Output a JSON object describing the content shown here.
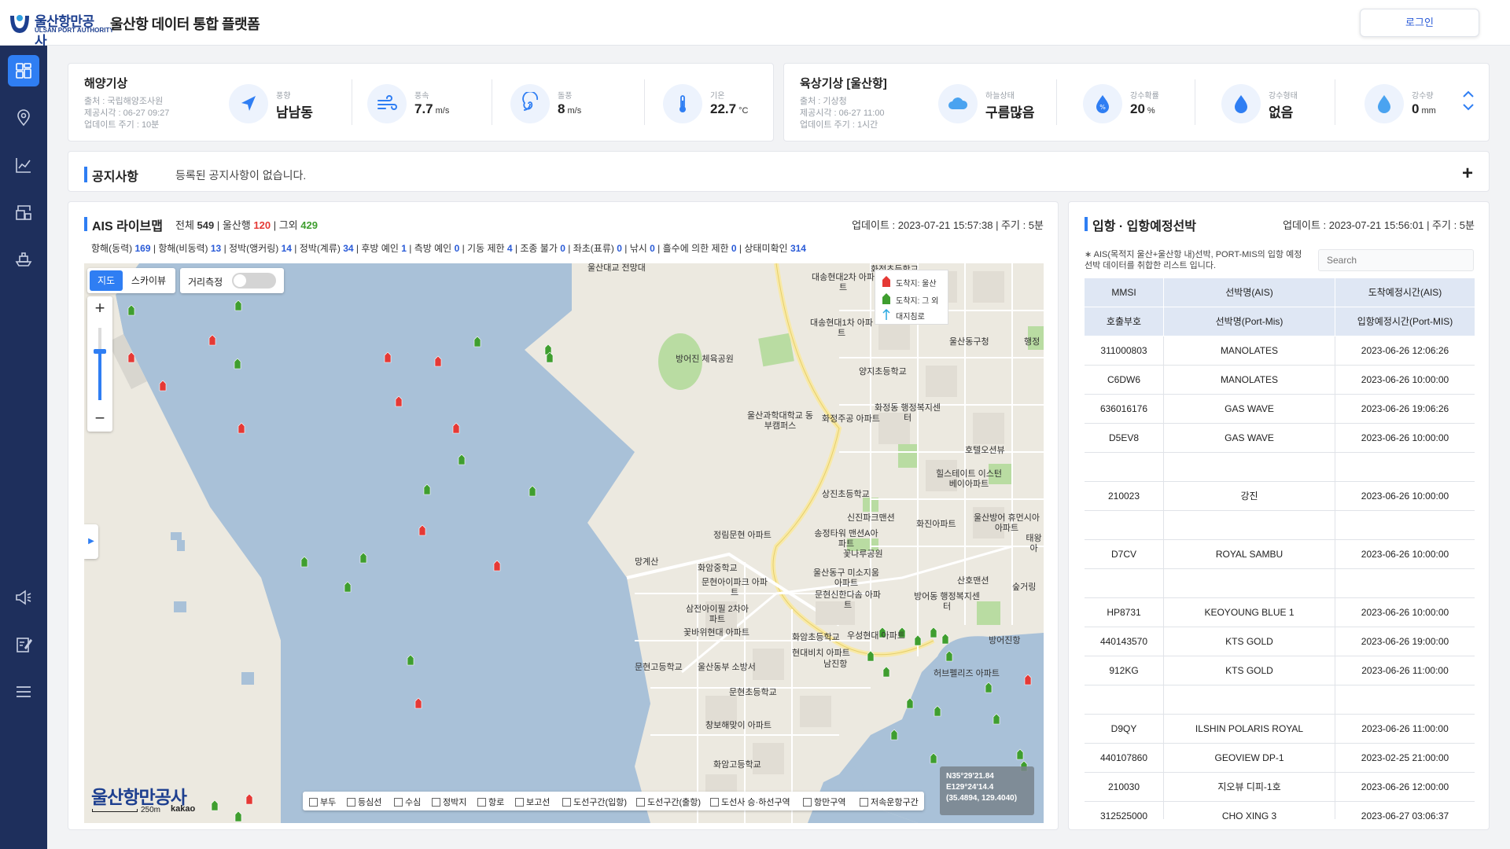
{
  "header": {
    "logo_ko": "울산항만공사",
    "logo_en": "ULSAN PORT AUTHORITY",
    "title": "울산항 데이터 통합 플랫폼",
    "login": "로그인"
  },
  "sidebar": {
    "items": [
      {
        "icon": "dashboard-icon",
        "active": true
      },
      {
        "icon": "location-pin-icon"
      },
      {
        "icon": "line-chart-icon"
      },
      {
        "icon": "port-crane-icon"
      },
      {
        "icon": "ship-icon"
      },
      {
        "icon": "megaphone-icon"
      },
      {
        "icon": "edit-note-icon"
      },
      {
        "icon": "menu-icon"
      }
    ]
  },
  "marine_weather": {
    "title": "해양기상",
    "source": "출처 : 국립해양조사원",
    "time": "제공시각 : 06-27 09:27",
    "cycle": "업데이트 주기 : 10분",
    "items": [
      {
        "icon": "wind-direction-icon",
        "label": "풍향",
        "value": "남남동",
        "unit": ""
      },
      {
        "icon": "wind-icon",
        "label": "풍속",
        "value": "7.7",
        "unit": "m/s"
      },
      {
        "icon": "gust-icon",
        "label": "돌풍",
        "value": "8",
        "unit": "m/s"
      },
      {
        "icon": "thermometer-icon",
        "label": "기온",
        "value": "22.7",
        "unit": "°C"
      }
    ]
  },
  "land_weather": {
    "title": "육상기상 [울산항]",
    "source": "출처 : 기상청",
    "time": "제공시각 : 06-27 11:00",
    "cycle": "업데이트 주기 : 1시간",
    "items": [
      {
        "icon": "cloud-icon",
        "label": "하늘상태",
        "value": "구름많음",
        "unit": ""
      },
      {
        "icon": "rain-probability-icon",
        "label": "강수확률",
        "value": "20",
        "unit": "%"
      },
      {
        "icon": "rain-type-icon",
        "label": "강수형태",
        "value": "없음",
        "unit": ""
      },
      {
        "icon": "raindrop-icon",
        "label": "강수량",
        "value": "0",
        "unit": "mm"
      }
    ]
  },
  "notice": {
    "title": "공지사항",
    "text": "등록된 공지사항이 없습니다.",
    "add": "+"
  },
  "ais": {
    "title": "AIS 라이브맵",
    "total_label": "전체",
    "total": "549",
    "ulsan_label": "울산행",
    "ulsan": "120",
    "other_label": "그외",
    "other": "429",
    "update": "업데이트 : 2023-07-21 15:57:38 | 주기 : 5분",
    "status": [
      {
        "label": "항해(동력)",
        "value": "169"
      },
      {
        "label": "항해(비동력)",
        "value": "13"
      },
      {
        "label": "정박(앵커링)",
        "value": "14"
      },
      {
        "label": "정박(계류)",
        "value": "34"
      },
      {
        "label": "후방 예인",
        "value": "1"
      },
      {
        "label": "측방 예인",
        "value": "0"
      },
      {
        "label": "기동 제한",
        "value": "4"
      },
      {
        "label": "조종 불가",
        "value": "0"
      },
      {
        "label": "좌초(표류)",
        "value": "0"
      },
      {
        "label": "낚시",
        "value": "0"
      },
      {
        "label": "흘수에 의한 제한",
        "value": "0"
      },
      {
        "label": "상태미확인",
        "value": "314"
      }
    ],
    "map": {
      "tab_map": "지도",
      "tab_sky": "스카이뷰",
      "distance": "거리측정",
      "distance_on": false,
      "zoom_level": 0.67,
      "zoom_in": "+",
      "zoom_out": "−",
      "legend": [
        "도착지: 울산",
        "도착지: 그 외",
        "대지침로"
      ],
      "legend_colors": [
        "#e53935",
        "#3f9e2f",
        "#29a8e0"
      ],
      "coord": [
        "N35°29'21.84",
        "E129°24'14.4",
        "(35.4894, 129.4040)"
      ],
      "brand": "울산항만공사",
      "scale": "250m",
      "kakao": "kakao",
      "layers": [
        "부두",
        "등심선",
        "수심",
        "정박지",
        "항로",
        "보고선",
        "도선구간(입항)",
        "도선구간(출항)",
        "도선사 승·하선구역",
        "항만구역",
        "저속운항구간"
      ],
      "places": [
        "울산대교 전망대",
        "화정초등학교",
        "대송현대2차 아파트",
        "대송현대1차 아파트",
        "방어진 체육공원",
        "양지초등학교",
        "화정동 행정복지센터",
        "울산과학대학교 동부캠퍼스",
        "화정주공 아파트",
        "울산동구청",
        "행정",
        "호텔오션뷰",
        "힐스테이트 이스턴베이아파트",
        "상진초등학교",
        "신진파크맨션",
        "화진아파트",
        "울산방어 휴먼시아아파트",
        "태왕 아",
        "정림문현 아파트",
        "망계산",
        "송정타워 맨션A아파트",
        "꽃나루공원",
        "화암중학교",
        "울산동구 미소지움아파트",
        "산호맨션",
        "숲거링",
        "문현아이파크 아파트",
        "문현신한다솜 아파트",
        "방어동 행정복지센터",
        "삼전아이필 2차아파트",
        "꽃바위현대 아파트",
        "화암초등학교",
        "우성현대 아파트",
        "방어진항",
        "현대비치 아파트",
        "문현고등학교",
        "울산동부 소방서",
        "남진항",
        "허브펠리즈 아파트",
        "문현초등학교",
        "창보해맞이 아파트",
        "화암고등학교"
      ]
    }
  },
  "arrivals": {
    "title": "입항 · 입항예정선박",
    "update": "업데이트 : 2023-07-21 15:56:01 | 주기 : 5분",
    "note": "∗ AIS(목적지 울산+울산항 내)선박, PORT-MIS의 입항 예정 선박 데이터를 취합한 리스트 입니다.",
    "search_placeholder": "Search",
    "headers": [
      [
        "MMSI",
        "선박명(AIS)",
        "도착예정시간(AIS)"
      ],
      [
        "호출부호",
        "선박명(Port-Mis)",
        "입항예정시간(Port-MIS)"
      ]
    ],
    "rows": [
      [
        "311000803",
        "MANOLATES",
        "2023-06-26 12:06:26"
      ],
      [
        "C6DW6",
        "MANOLATES",
        "2023-06-26 10:00:00"
      ],
      [
        "636016176",
        "GAS WAVE",
        "2023-06-26 19:06:26"
      ],
      [
        "D5EV8",
        "GAS WAVE",
        "2023-06-26 10:00:00"
      ],
      [
        "",
        "",
        ""
      ],
      [
        "210023",
        "강진",
        "2023-06-26 10:00:00"
      ],
      [
        "",
        "",
        ""
      ],
      [
        "D7CV",
        "ROYAL SAMBU",
        "2023-06-26 10:00:00"
      ],
      [
        "",
        "",
        ""
      ],
      [
        "HP8731",
        "KEOYOUNG BLUE 1",
        "2023-06-26 10:00:00"
      ],
      [
        "440143570",
        "KTS GOLD",
        "2023-06-26 19:00:00"
      ],
      [
        "912KG",
        "KTS GOLD",
        "2023-06-26 11:00:00"
      ],
      [
        "",
        "",
        ""
      ],
      [
        "D9QY",
        "ILSHIN POLARIS ROYAL",
        "2023-06-26 11:00:00"
      ],
      [
        "440107860",
        "GEOVIEW DP-1",
        "2023-02-25 21:00:00"
      ],
      [
        "210030",
        "지오뷰 디피-1호",
        "2023-06-26 12:00:00"
      ],
      [
        "312525000",
        "CHO XING 3",
        "2023-06-27 03:06:37"
      ]
    ]
  }
}
